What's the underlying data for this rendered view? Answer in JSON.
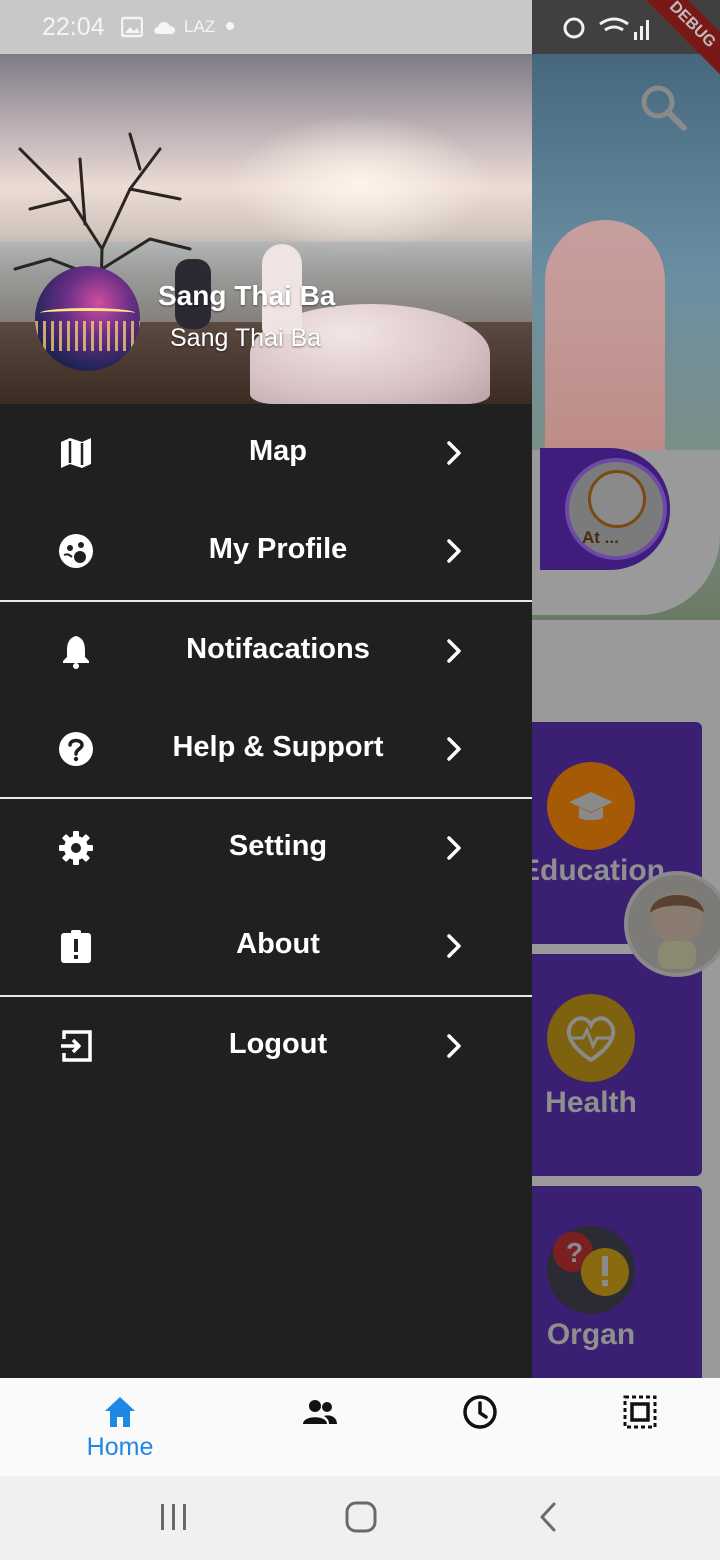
{
  "status_bar": {
    "time": "22:04",
    "carrier_badge": "LAZ",
    "debug_banner": "DEBUG"
  },
  "drawer": {
    "user_name": "Sang Thai Ba",
    "user_subtitle": "Sang Thai Ba",
    "menu": [
      {
        "label": "Map",
        "icon": "map-icon"
      },
      {
        "label": "My Profile",
        "icon": "profile-icon"
      },
      {
        "label": "Notifacations",
        "icon": "bell-icon"
      },
      {
        "label": "Help & Support",
        "icon": "help-icon"
      },
      {
        "label": "Setting",
        "icon": "gear-icon"
      },
      {
        "label": "About",
        "icon": "about-icon"
      },
      {
        "label": "Logout",
        "icon": "logout-icon"
      }
    ]
  },
  "background": {
    "category_chip_label": "At ...",
    "cards": [
      {
        "label": "Education",
        "icon": "graduation-cap-icon",
        "color": "#c36a00"
      },
      {
        "label": "Health",
        "icon": "heart-pulse-icon",
        "color": "#8a6a10"
      },
      {
        "label": "Organ",
        "icon": "question-exclamation-icon",
        "color": "#2f2f3a"
      }
    ]
  },
  "bottom_nav": {
    "tabs": [
      {
        "label": "Home",
        "icon": "home-icon",
        "active": true
      },
      {
        "label": "",
        "icon": "people-icon",
        "active": false
      },
      {
        "label": "",
        "icon": "clock-icon",
        "active": false
      },
      {
        "label": "",
        "icon": "select-all-icon",
        "active": false
      }
    ],
    "active_color": "#1e88e5"
  },
  "colors": {
    "drawer_bg": "#202020",
    "text_primary": "#ffffff",
    "accent": "#1e88e5"
  }
}
